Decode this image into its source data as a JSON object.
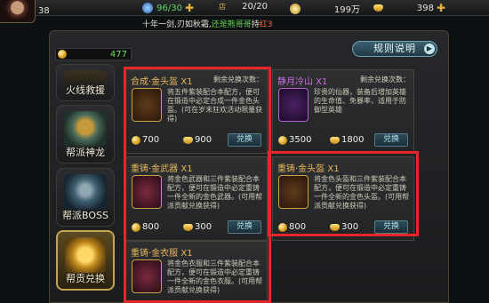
{
  "player": {
    "level": "38"
  },
  "resources": {
    "stamina": "96/30",
    "shop_value": "20/20",
    "shop_icon_label": "店",
    "silver": "199万",
    "gold": "398"
  },
  "marquee": {
    "prefix": "十年一剑,刃如秋霜,",
    "highlight": "还是熊哥哥",
    "middle": "持",
    "highlight2": "红3"
  },
  "rules_button": {
    "label": "规则说明"
  },
  "balance": {
    "value": "477"
  },
  "side_menu": [
    {
      "label": "火线救援"
    },
    {
      "label": "帮派神龙"
    },
    {
      "label": "帮派BOSS"
    },
    {
      "label": "帮贡兑换"
    }
  ],
  "cards": [
    {
      "title": "合成·金头盔 X1",
      "remain": "剩余兑换次数：",
      "desc": "将五件紫装配合本配方，便可在锻造中必定合成一件金色头盔。(可在岁末狂欢活动限量获得)",
      "price_coin": "700",
      "price_ingot": "900",
      "button": "兑换"
    },
    {
      "title": "静月冷山 X1",
      "remain": "剩余兑换次数：",
      "desc": "珍贵的仙器，装备后增加英雄的生命值、免暴率，适用于防御型英雄",
      "price_coin": "3500",
      "price_ingot": "1800",
      "button": "兑换"
    },
    {
      "title": "重铸·金武器 X1",
      "desc": "将金色武器和三件紫装配合本配方，便可在锻造中必定重铸一件全新的金色武器。(可用帮派贡献兑换获得)",
      "price_coin": "800",
      "price_ingot": "300",
      "button": "兑换"
    },
    {
      "title": "重铸·金头盔 X1",
      "desc": "将金色头盔和三件紫装配合本配方，便可在锻造中必定重铸一件全新的金色头盔。(可用帮派贡献兑换获得)",
      "price_coin": "800",
      "price_ingot": "300",
      "button": "兑换"
    },
    {
      "title": "重铸·金衣服 X1",
      "desc": "将金色衣服和三件紫装配合本配方，便可在锻造中必定重铸一件全新的金色衣服。(可用帮派贡献兑换获得)"
    }
  ],
  "colors": {
    "highlight_frame": "#e8262a",
    "title_gold": "#eab85a",
    "title_purple": "#d06be6",
    "balance_green": "#6fdf59"
  }
}
